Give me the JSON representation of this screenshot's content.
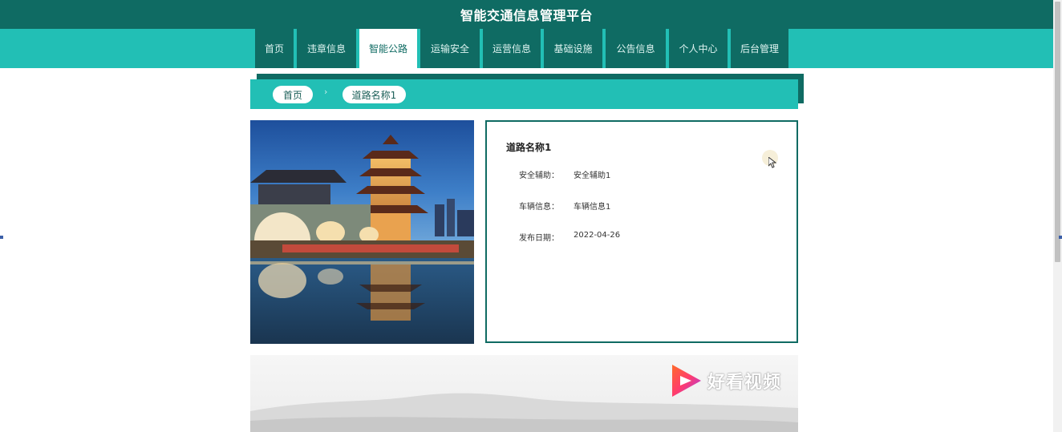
{
  "header": {
    "site_title": "智能交通信息管理平台"
  },
  "nav": {
    "items": [
      {
        "label": "首页"
      },
      {
        "label": "违章信息"
      },
      {
        "label": "智能公路"
      },
      {
        "label": "运输安全"
      },
      {
        "label": "运营信息"
      },
      {
        "label": "基础设施"
      },
      {
        "label": "公告信息"
      },
      {
        "label": "个人中心"
      },
      {
        "label": "后台管理"
      }
    ],
    "active_index": 2
  },
  "breadcrumb": {
    "home": "首页",
    "current": "道路名称1"
  },
  "detail": {
    "title": "道路名称1",
    "fields": [
      {
        "label": "安全辅助：",
        "value": "安全辅助1"
      },
      {
        "label": "车辆信息：",
        "value": "车辆信息1"
      },
      {
        "label": "发布日期：",
        "value": "2022-04-26"
      }
    ]
  },
  "video": {
    "watermark": "好看视频"
  },
  "colors": {
    "primary_dark": "#0f6b63",
    "primary": "#22bfb5",
    "white": "#ffffff"
  }
}
